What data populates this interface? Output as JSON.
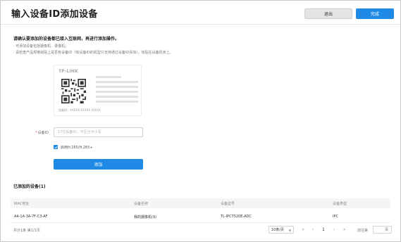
{
  "header": {
    "title": "输入设备ID添加设备",
    "exit_label": "退出",
    "done_label": "完成"
  },
  "notice": {
    "title": "请确认要添加的设备都已接入互联网，再进行添加操作。",
    "lines": [
      "· 可添加设备包括摄像机、录像机。",
      "· 请检查产品规格铭贴上是否有设备ID（有设备ID的机型只支持通过设备ID添加），铭贴在设备机身上。"
    ]
  },
  "card": {
    "brand": "TP-LINK",
    "caption": "设备ID：XXXXX XXXXX XXXXX"
  },
  "form": {
    "id_label": "设备ID",
    "required_mark": "*",
    "id_placeholder": "17位设备ID，不区分大小写",
    "id_value": "",
    "h265_label": "启用H.265/H.265+",
    "h265_checked": true,
    "add_label": "添加"
  },
  "devices": {
    "title": "已添加的设备(1)",
    "columns": [
      "MAC地址",
      "设备名称",
      "设备型号",
      "设备类型"
    ],
    "rows": [
      [
        "A4-1A-3A-7F-C3-AF",
        "我的摄像机(9)",
        "TL-IPC7520E-ADC",
        "IPC"
      ]
    ]
  },
  "pagination": {
    "summary": "共计1条  第1/1页",
    "page_size": "10条/页",
    "first": "«",
    "prev": "‹",
    "current": "1",
    "next": "›",
    "last": "»",
    "goto_label": "前往第",
    "goto_suffix": "页"
  },
  "colors": {
    "primary": "#1e8ae6",
    "required": "#e64545"
  }
}
